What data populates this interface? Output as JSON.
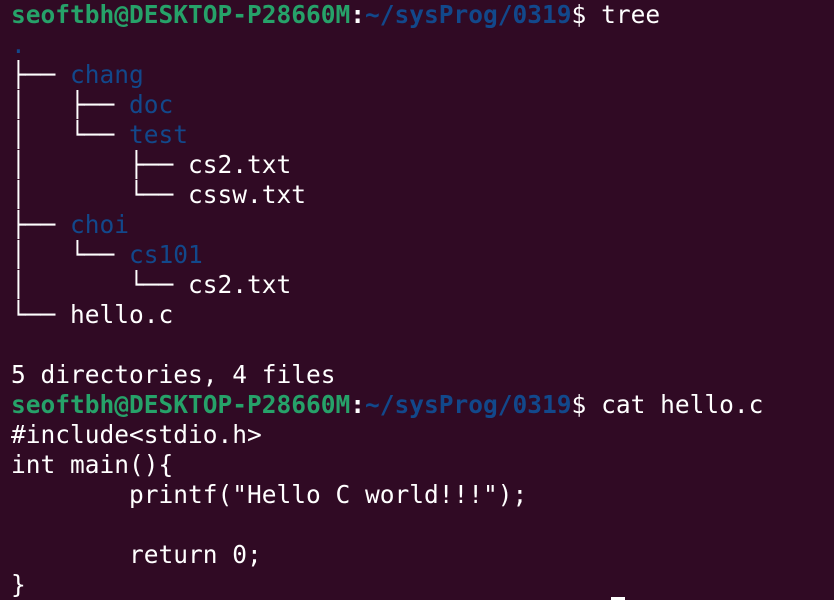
{
  "prompt": {
    "user_host": "seoftbh@DESKTOP-P28660M",
    "colon": ":",
    "path": "~/sysProg/0319",
    "dollar": "$ "
  },
  "commands": {
    "first": "tree",
    "second": "cat hello.c"
  },
  "tree_output": [
    {
      "prefix": "",
      "name": ".",
      "type": "dir"
    },
    {
      "prefix": "├── ",
      "name": "chang",
      "type": "dir"
    },
    {
      "prefix": "│   ├── ",
      "name": "doc",
      "type": "dir"
    },
    {
      "prefix": "│   └── ",
      "name": "test",
      "type": "dir"
    },
    {
      "prefix": "│       ├── ",
      "name": "cs2.txt",
      "type": "file"
    },
    {
      "prefix": "│       └── ",
      "name": "cssw.txt",
      "type": "file"
    },
    {
      "prefix": "├── ",
      "name": "choi",
      "type": "dir"
    },
    {
      "prefix": "│   └── ",
      "name": "cs101",
      "type": "dir"
    },
    {
      "prefix": "│       └── ",
      "name": "cs2.txt",
      "type": "file"
    },
    {
      "prefix": "└── ",
      "name": "hello.c",
      "type": "file"
    }
  ],
  "tree_summary": "5 directories, 4 files",
  "file_contents": [
    "#include<stdio.h>",
    "int main(){",
    "        printf(\"Hello C world!!!\");",
    "",
    "        return 0;",
    "}"
  ],
  "colors": {
    "background": "#300a24",
    "prompt_user": "#26a269",
    "prompt_path": "#12488b",
    "directory": "#12488b",
    "text": "#ffffff"
  }
}
